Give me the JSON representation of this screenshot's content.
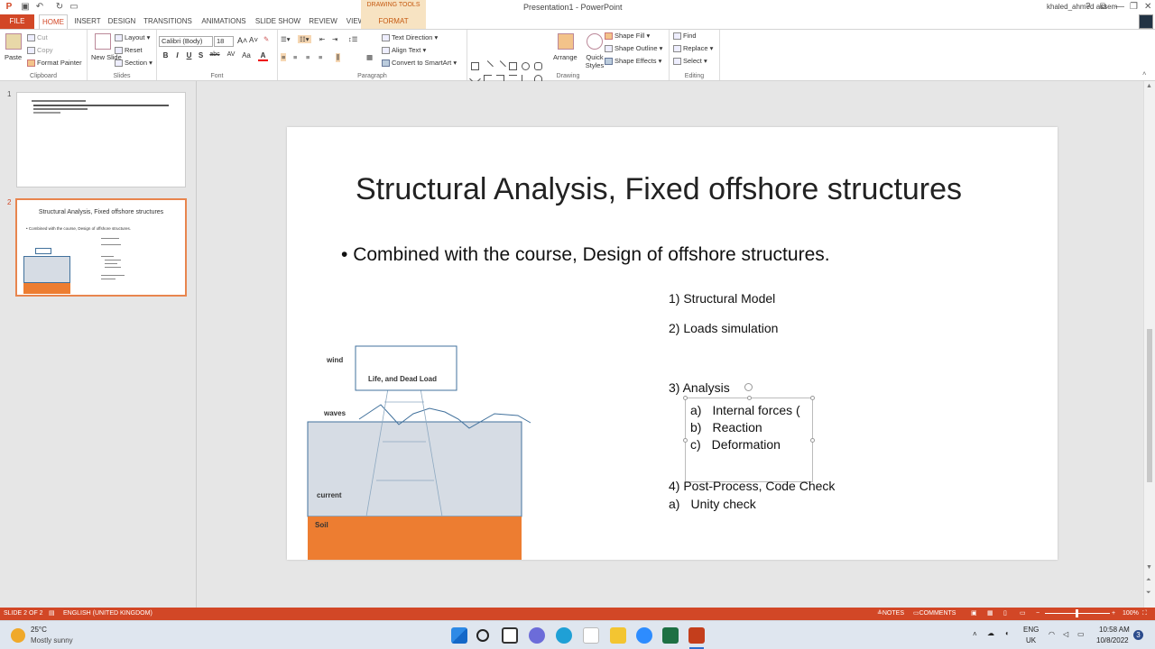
{
  "titlebar": {
    "title": "Presentation1 - PowerPoint",
    "user": "khaled_ahmed assem",
    "controls": [
      "?",
      "⧉",
      "—",
      "❐",
      "✕"
    ]
  },
  "tabs": {
    "file": "FILE",
    "items": [
      "HOME",
      "INSERT",
      "DESIGN",
      "TRANSITIONS",
      "ANIMATIONS",
      "SLIDE SHOW",
      "REVIEW",
      "VIEW"
    ],
    "contextual_group": "DRAWING TOOLS",
    "contextual_tab": "FORMAT"
  },
  "ribbon": {
    "clipboard": {
      "label": "Clipboard",
      "paste": "Paste",
      "cut": "Cut",
      "copy": "Copy",
      "format_painter": "Format Painter"
    },
    "slides": {
      "label": "Slides",
      "new_slide": "New Slide",
      "layout": "Layout",
      "reset": "Reset",
      "section": "Section"
    },
    "font": {
      "label": "Font",
      "family": "Calibri (Body)",
      "size": "18",
      "bold": "B",
      "italic": "I",
      "underline": "U",
      "shadow": "S",
      "strike": "abc",
      "spacing": "AV",
      "case": "Aa",
      "color": "A"
    },
    "paragraph": {
      "label": "Paragraph",
      "text_direction": "Text Direction",
      "align_text": "Align Text",
      "smartart": "Convert to SmartArt"
    },
    "drawing": {
      "label": "Drawing",
      "arrange": "Arrange",
      "quick_styles": "Quick Styles",
      "shape_fill": "Shape Fill",
      "shape_outline": "Shape Outline",
      "shape_effects": "Shape Effects"
    },
    "editing": {
      "label": "Editing",
      "find": "Find",
      "replace": "Replace",
      "select": "Select"
    }
  },
  "thumbnails": {
    "slide1_num": "1",
    "slide2_num": "2",
    "slide2_title": "Structural Analysis, Fixed offshore structures",
    "slide2_bullet": "• Combined with the course, Design of offshore structures."
  },
  "slide": {
    "title": "Structural Analysis, Fixed offshore structures",
    "bullet_mark": "•",
    "bullet": "Combined with the course, Design of offshore structures.",
    "steps": {
      "s1": "1) Structural Model",
      "s2": "2) Loads simulation",
      "s3": "3) Analysis",
      "s3a_mark": "a)",
      "s3a": "Internal forces (",
      "s3b_mark": "b)",
      "s3b": "Reaction",
      "s3c_mark": "c)",
      "s3c": "Deformation",
      "s4": "4) Post-Process, Code Check",
      "s4a_mark": "a)",
      "s4a": "Unity check"
    },
    "diagram": {
      "wind": "wind",
      "deck": "Life, and Dead Load",
      "waves": "waves",
      "current": "current",
      "soil": "Soil",
      "colors": {
        "water": "#d6dce4",
        "soil": "#ed7d31",
        "stroke": "#41719c"
      }
    }
  },
  "statusbar": {
    "slide": "SLIDE 2 OF 2",
    "language": "ENGLISH (UNITED KINGDOM)",
    "notes": "NOTES",
    "comments": "COMMENTS",
    "zoom": "100%"
  },
  "taskbar": {
    "temp": "25°C",
    "weather": "Mostly sunny",
    "lang1": "ENG",
    "lang2": "UK",
    "time": "10:58 AM",
    "date": "10/8/2022",
    "notif": "3"
  }
}
